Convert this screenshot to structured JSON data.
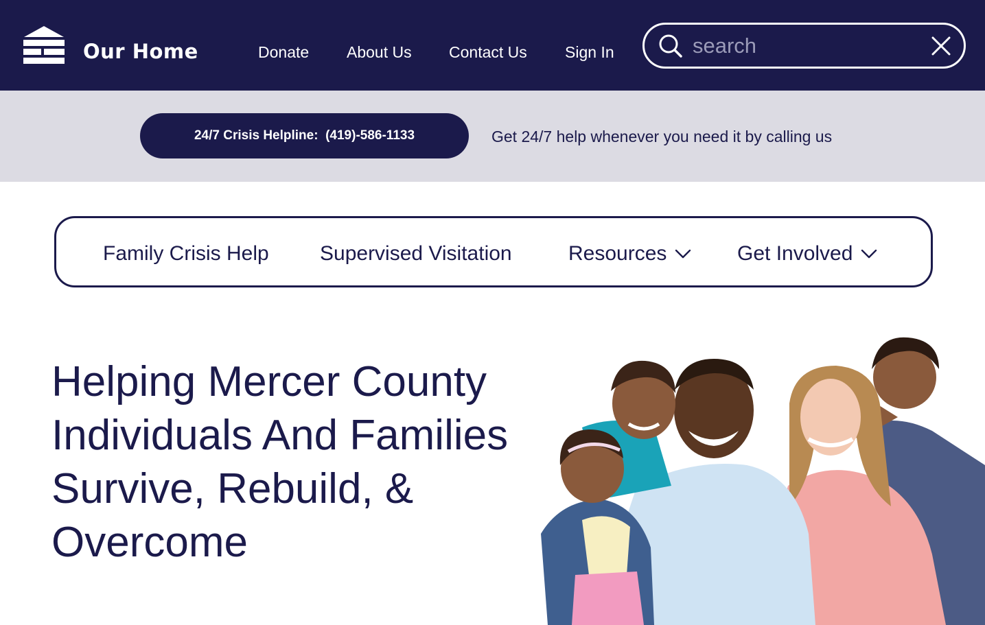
{
  "header": {
    "brand": "Our Home",
    "logo_icon": "house-logo-icon",
    "nav": [
      {
        "label": "Donate"
      },
      {
        "label": "About Us"
      },
      {
        "label": "Contact Us"
      },
      {
        "label": "Sign In"
      }
    ],
    "search": {
      "placeholder": "search",
      "value": "",
      "icon": "search-icon",
      "clear_icon": "close-icon"
    }
  },
  "helpline": {
    "button_label": "24/7 Crisis Helpline:  (419)-586-1133",
    "message": "Get 24/7 help whenever you need it by calling us"
  },
  "subnav": {
    "items": [
      {
        "label": "Family Crisis Help",
        "has_dropdown": false
      },
      {
        "label": "Supervised Visitation",
        "has_dropdown": false
      },
      {
        "label": "Resources",
        "has_dropdown": true
      },
      {
        "label": "Get Involved",
        "has_dropdown": true
      }
    ]
  },
  "hero": {
    "title": "Helping Mercer County Individuals And Families Survive, Rebuild, & Overcome",
    "image": "family-photo"
  },
  "colors": {
    "navy": "#1b1a4b",
    "band": "#dcdbe3",
    "white": "#ffffff"
  }
}
